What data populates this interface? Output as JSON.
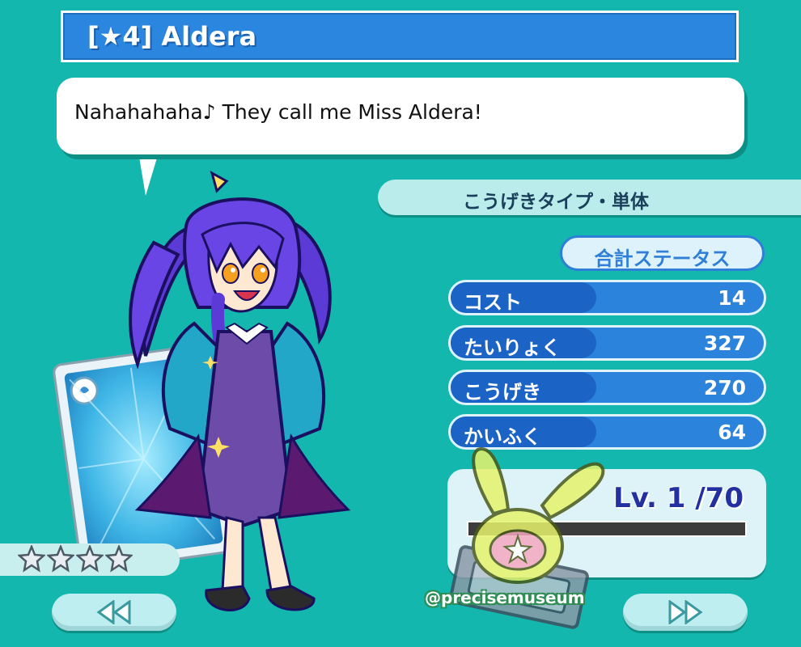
{
  "header": {
    "title": "[★4]  Aldera"
  },
  "dialogue": {
    "text": "Nahahahaha♪ They call me Miss Aldera!"
  },
  "attack_type": {
    "label": "こうげきタイプ・単体"
  },
  "status": {
    "total_label": "合計ステータス",
    "stats": [
      {
        "label": "コスト",
        "value": "14"
      },
      {
        "label": "たいりょく",
        "value": "327"
      },
      {
        "label": "こうげき",
        "value": "270"
      },
      {
        "label": "かいふく",
        "value": "64"
      }
    ]
  },
  "level": {
    "text": "Lv. 1 /70",
    "exp_fraction": 0
  },
  "rarity": {
    "stars": 4
  },
  "watermark": {
    "text": "@precisemuseum"
  },
  "colors": {
    "background": "#14b7ad",
    "title_bar": "#2a86df",
    "stat_row": "#2b83dc",
    "stat_label": "#1c63c6",
    "level_text": "#2330a0"
  },
  "icons": {
    "prev": "double-left-arrow-icon",
    "next": "double-right-arrow-icon",
    "star": "star-icon"
  }
}
